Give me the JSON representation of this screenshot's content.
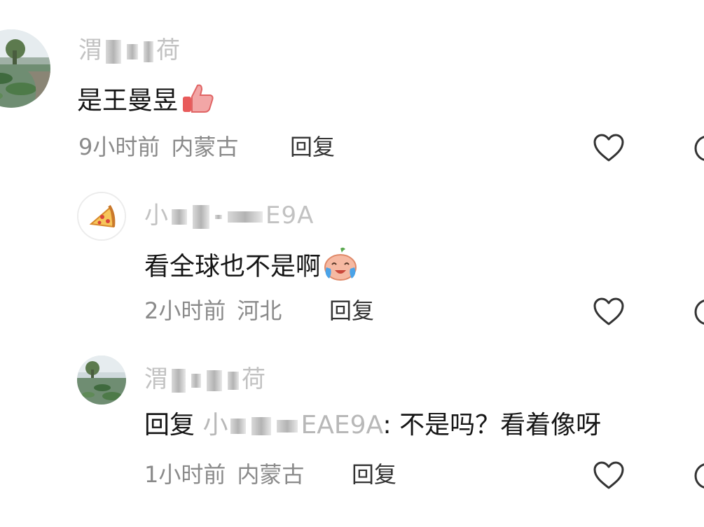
{
  "comments": [
    {
      "username_start": "渭",
      "username_end": "荷",
      "text": "是王曼昱",
      "emoji": "thumbs-up",
      "time": "9小时前",
      "location": "内蒙古",
      "reply_label": "回复"
    },
    {
      "username_start": "小",
      "username_end": "E9A",
      "text": "看全球也不是啊",
      "emoji": "crying-laughing",
      "time": "2小时前",
      "location": "河北",
      "reply_label": "回复"
    },
    {
      "username_start": "渭",
      "username_end": "荷",
      "reply_prefix": "回复",
      "reply_target_start": "小",
      "reply_target_end": "EAE9A",
      "text": ": 不是吗？看着像呀",
      "time": "1小时前",
      "location": "内蒙古",
      "reply_label": "回复"
    }
  ]
}
